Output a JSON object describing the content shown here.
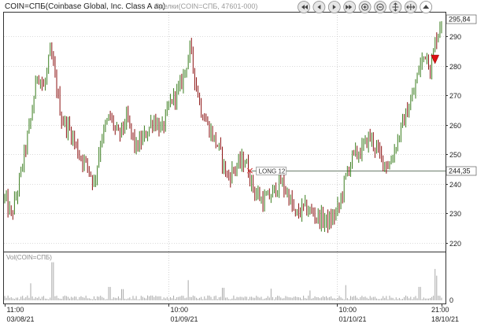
{
  "header": {
    "title": "COIN=СПБ(Coinbase Global, Inc. Class A ao)",
    "subtitle": "Сделки(COIN=СПБ, 47601-000)",
    "nav_buttons": [
      {
        "name": "scroll-first-button",
        "icon": "double-left-arrow-icon"
      },
      {
        "name": "scroll-left-button",
        "icon": "left-arrow-icon"
      },
      {
        "name": "scroll-right-button",
        "icon": "right-arrow-icon"
      },
      {
        "name": "scroll-last-button",
        "icon": "double-right-arrow-icon"
      },
      {
        "name": "zoom-in-button",
        "icon": "plus-icon"
      },
      {
        "name": "zoom-out-button",
        "icon": "minus-icon"
      },
      {
        "name": "fit-vertical-button",
        "icon": "expand-vertical-icon"
      },
      {
        "name": "fit-horizontal-button",
        "icon": "expand-horizontal-icon"
      },
      {
        "name": "scroll-up-button",
        "icon": "up-arrow-icon"
      }
    ]
  },
  "colors": {
    "up": "#3a7d1e",
    "down": "#8b1010",
    "grid": "#b8b8b8",
    "level_line": "#6b7d6b",
    "panel_border": "#333333",
    "sell_marker": "#dd1111",
    "buy_marker": "#d04040"
  },
  "chart_data": {
    "type": "candlestick",
    "y_axis": {
      "ticks": [
        220,
        230,
        240,
        250,
        260,
        270,
        280,
        290
      ],
      "ylim": [
        217,
        298
      ]
    },
    "current_price_label": "295,84",
    "current_price": 295.84,
    "level_line": {
      "label": "244,35",
      "value": 244.35
    },
    "trade_marker": {
      "text": "LONG 12",
      "price": 244.35,
      "series_index": 0.565
    },
    "sell_marker": {
      "price": 282,
      "series_index": 0.985
    },
    "x_axis": {
      "top_labels": [
        "11:00",
        "10:00",
        "10:00",
        "21:00"
      ],
      "bottom_labels": [
        "03/08/21",
        "01/09/21",
        "01/10/21",
        "18/10/21"
      ],
      "label_positions": [
        0.0,
        0.375,
        0.76,
        1.0
      ]
    },
    "price_anchors": [
      [
        0.0,
        235
      ],
      [
        0.015,
        229
      ],
      [
        0.03,
        238
      ],
      [
        0.045,
        250
      ],
      [
        0.06,
        262
      ],
      [
        0.075,
        278
      ],
      [
        0.09,
        272
      ],
      [
        0.105,
        285
      ],
      [
        0.115,
        276
      ],
      [
        0.13,
        262
      ],
      [
        0.15,
        258
      ],
      [
        0.17,
        250
      ],
      [
        0.19,
        246
      ],
      [
        0.205,
        240
      ],
      [
        0.22,
        255
      ],
      [
        0.24,
        263
      ],
      [
        0.26,
        256
      ],
      [
        0.28,
        262
      ],
      [
        0.3,
        252
      ],
      [
        0.32,
        256
      ],
      [
        0.34,
        262
      ],
      [
        0.36,
        258
      ],
      [
        0.38,
        268
      ],
      [
        0.4,
        272
      ],
      [
        0.415,
        280
      ],
      [
        0.425,
        286
      ],
      [
        0.435,
        276
      ],
      [
        0.45,
        265
      ],
      [
        0.47,
        258
      ],
      [
        0.49,
        252
      ],
      [
        0.51,
        242
      ],
      [
        0.53,
        246
      ],
      [
        0.55,
        248
      ],
      [
        0.57,
        238
      ],
      [
        0.59,
        234
      ],
      [
        0.61,
        236
      ],
      [
        0.63,
        241
      ],
      [
        0.65,
        236
      ],
      [
        0.665,
        229
      ],
      [
        0.685,
        232
      ],
      [
        0.705,
        230
      ],
      [
        0.725,
        228
      ],
      [
        0.745,
        227
      ],
      [
        0.765,
        232
      ],
      [
        0.78,
        242
      ],
      [
        0.795,
        249
      ],
      [
        0.815,
        251
      ],
      [
        0.835,
        256
      ],
      [
        0.85,
        252
      ],
      [
        0.865,
        248
      ],
      [
        0.88,
        246
      ],
      [
        0.895,
        253
      ],
      [
        0.915,
        262
      ],
      [
        0.935,
        270
      ],
      [
        0.95,
        280
      ],
      [
        0.965,
        285
      ],
      [
        0.975,
        278
      ],
      [
        0.985,
        288
      ],
      [
        1.0,
        295.5
      ]
    ],
    "volume_panel": {
      "label": "Vol(COIN=СПБ)",
      "tick": 0,
      "ylim": [
        0,
        100
      ],
      "spikes": [
        [
          0.11,
          85
        ],
        [
          0.06,
          38
        ],
        [
          0.24,
          30
        ],
        [
          0.27,
          25
        ],
        [
          0.42,
          45
        ],
        [
          0.5,
          28
        ],
        [
          0.61,
          26
        ],
        [
          0.7,
          22
        ],
        [
          0.78,
          34
        ],
        [
          0.95,
          30
        ],
        [
          0.985,
          70
        ],
        [
          0.99,
          55
        ]
      ]
    }
  }
}
